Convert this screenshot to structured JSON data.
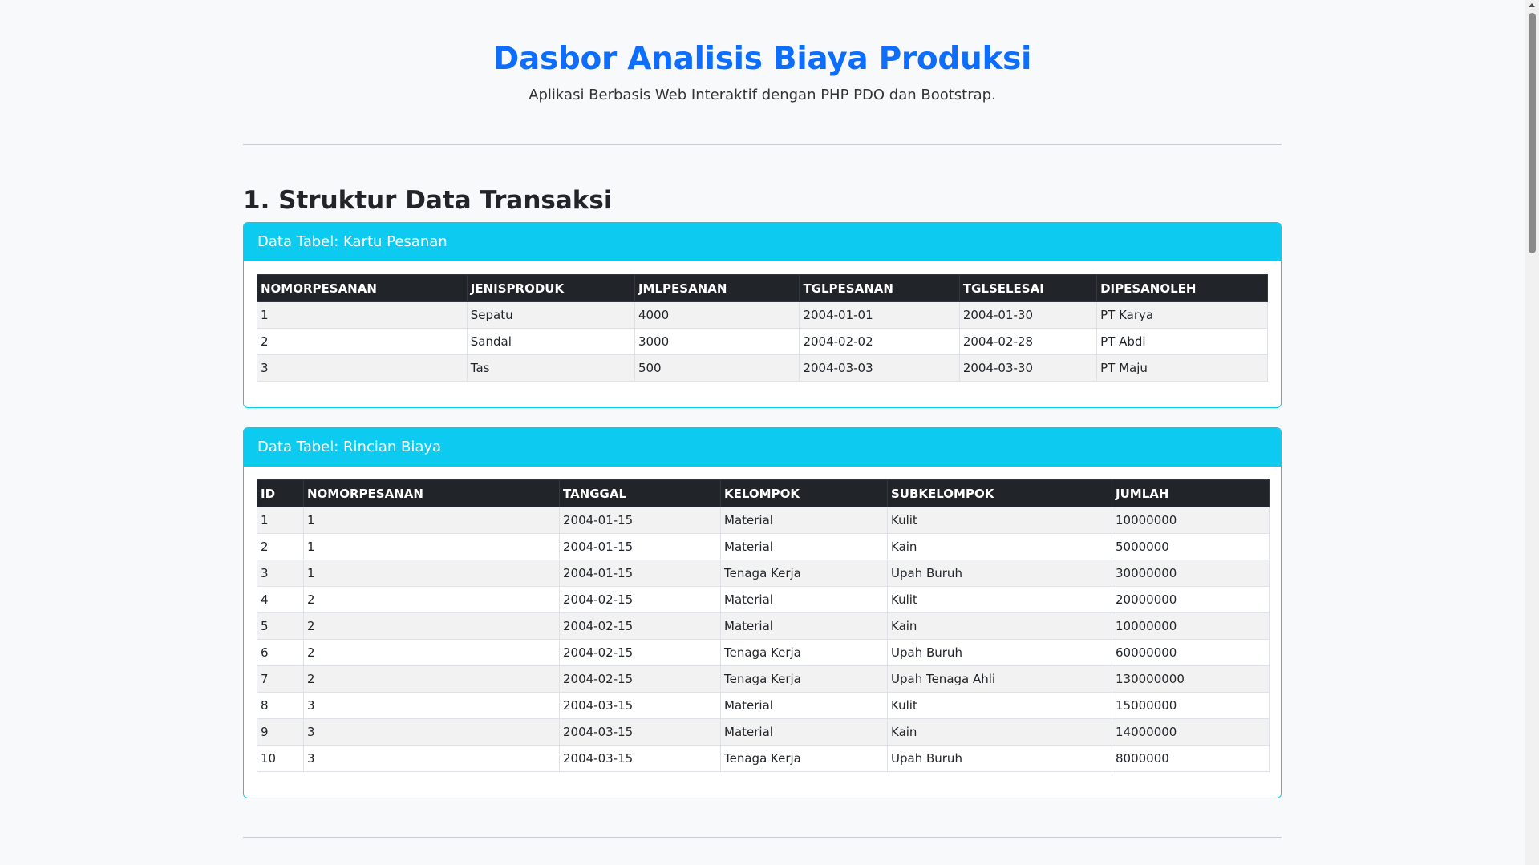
{
  "header": {
    "title": "Dasbor Analisis Biaya Produksi",
    "subtitle": "Aplikasi Berbasis Web Interaktif dengan PHP PDO dan Bootstrap."
  },
  "section1": {
    "title": "1. Struktur Data Transaksi"
  },
  "kartu_pesanan": {
    "card_title": "Data Tabel: Kartu Pesanan",
    "columns": [
      "NOMORPESANAN",
      "JENISPRODUK",
      "JMLPESANAN",
      "TGLPESANAN",
      "TGLSELESAI",
      "DIPESANOLEH"
    ],
    "rows": [
      [
        "1",
        "Sepatu",
        "4000",
        "2004-01-01",
        "2004-01-30",
        "PT Karya"
      ],
      [
        "2",
        "Sandal",
        "3000",
        "2004-02-02",
        "2004-02-28",
        "PT Abdi"
      ],
      [
        "3",
        "Tas",
        "500",
        "2004-03-03",
        "2004-03-30",
        "PT Maju"
      ]
    ]
  },
  "rincian_biaya": {
    "card_title": "Data Tabel: Rincian Biaya",
    "columns": [
      "ID",
      "NOMORPESANAN",
      "TANGGAL",
      "KELOMPOK",
      "SUBKELOMPOK",
      "JUMLAH"
    ],
    "rows": [
      [
        "1",
        "1",
        "2004-01-15",
        "Material",
        "Kulit",
        "10000000"
      ],
      [
        "2",
        "1",
        "2004-01-15",
        "Material",
        "Kain",
        "5000000"
      ],
      [
        "3",
        "1",
        "2004-01-15",
        "Tenaga Kerja",
        "Upah Buruh",
        "30000000"
      ],
      [
        "4",
        "2",
        "2004-02-15",
        "Material",
        "Kulit",
        "20000000"
      ],
      [
        "5",
        "2",
        "2004-02-15",
        "Material",
        "Kain",
        "10000000"
      ],
      [
        "6",
        "2",
        "2004-02-15",
        "Tenaga Kerja",
        "Upah Buruh",
        "60000000"
      ],
      [
        "7",
        "2",
        "2004-02-15",
        "Tenaga Kerja",
        "Upah Tenaga Ahli",
        "130000000"
      ],
      [
        "8",
        "3",
        "2004-03-15",
        "Material",
        "Kulit",
        "15000000"
      ],
      [
        "9",
        "3",
        "2004-03-15",
        "Material",
        "Kain",
        "14000000"
      ],
      [
        "10",
        "3",
        "2004-03-15",
        "Tenaga Kerja",
        "Upah Buruh",
        "8000000"
      ]
    ]
  },
  "colors": {
    "title_blue": "#0d6efd",
    "card_header_cyan": "#0dcaf0",
    "table_header_dark": "#212529"
  }
}
